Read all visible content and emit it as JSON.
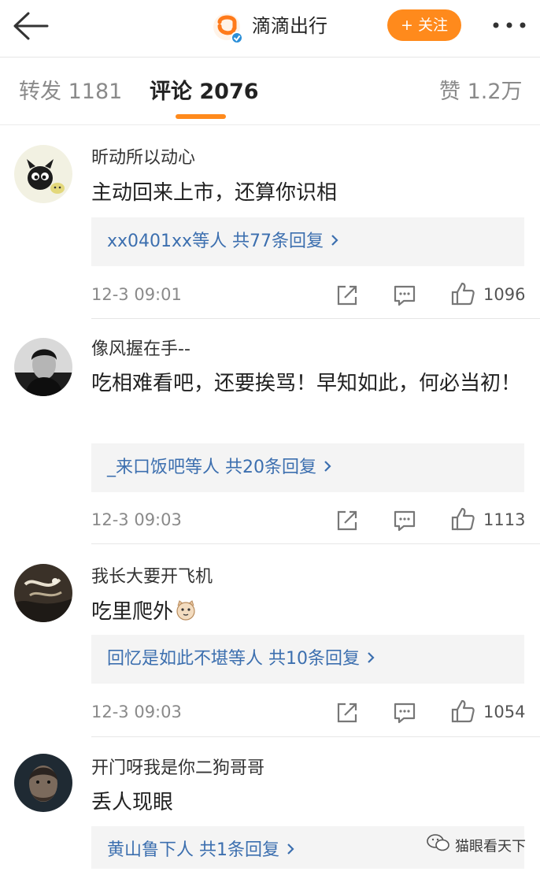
{
  "header": {
    "account_name": "滴滴出行",
    "follow_label": "+ 关注",
    "brand_color": "#ff8a1c"
  },
  "tabs": [
    {
      "label": "转发 1181",
      "active": false
    },
    {
      "label": "评论 2076",
      "active": true
    },
    {
      "label": "赞 1.2万",
      "active": false
    }
  ],
  "comments": [
    {
      "username": "昕动所以动心",
      "text": "主动回来上市，还算你识相",
      "replies": "xx0401xx等人  共77条回复",
      "time": "12-3 09:01",
      "likes": "1096"
    },
    {
      "username": "像风握在手--",
      "text": "吃相难看吧，还要挨骂！早知如此，何必当初！",
      "replies": "_来口饭吧等人  共20条回复",
      "time": "12-3 09:03",
      "likes": "1113"
    },
    {
      "username": "我长大要开飞机",
      "text": "吃里爬外",
      "replies": "回忆是如此不堪等人  共10条回复",
      "time": "12-3 09:03",
      "likes": "1054"
    },
    {
      "username": "开门呀我是你二狗哥哥",
      "text": "丢人现眼",
      "replies": "黄山鲁下人  共1条回复"
    }
  ],
  "watermark": "猫眼看天下",
  "icons": {
    "back": "back-arrow-icon",
    "more": "more-dots-icon",
    "repost": "repost-icon",
    "comment": "comment-icon",
    "like": "thumbs-up-icon",
    "chevron": "chevron-right-icon",
    "emoji": "cat-emoji-icon"
  }
}
